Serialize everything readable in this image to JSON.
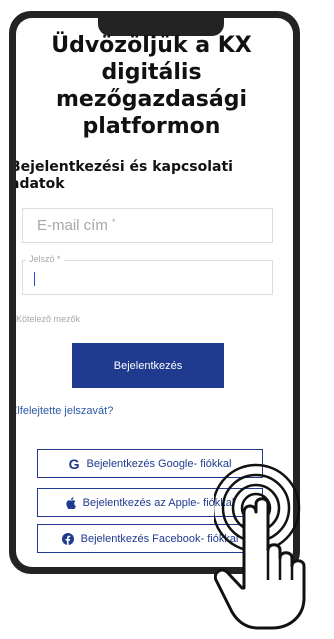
{
  "header": {
    "title": "Üdvözöljük a KX digitális mezőgazdasági platformon"
  },
  "form": {
    "section_title": "Bejelentkezési és kapcsolati adatok",
    "email_placeholder": "E-mail cím",
    "password_label": "Jelszó",
    "required_mark": "*",
    "required_note": "* Kötelező mezők",
    "login_button": "Bejelentkezés",
    "forgot_link": "Elfelejtette jelszavát?"
  },
  "social": {
    "google_label": "Bejelentkezés Google- fiókkal",
    "apple_label": "Bejelentkezés az Apple- fiókkal",
    "facebook_label": "Bejelentkezés Facebook- fiókkal",
    "google_icon_glyph": "G"
  },
  "icons": [
    "google-icon",
    "apple-icon",
    "facebook-icon",
    "pointing-hand-icon"
  ],
  "colors": {
    "accent": "#1f3a8f",
    "link": "#2b5aa6",
    "device_frame": "#232323"
  }
}
